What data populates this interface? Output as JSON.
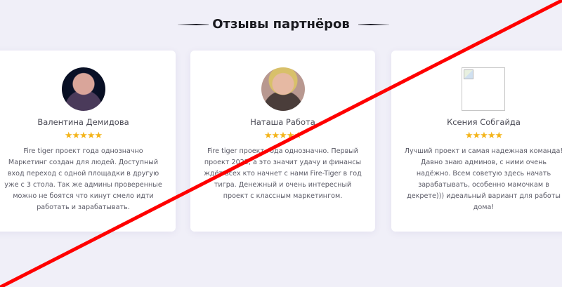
{
  "section": {
    "title": "Отзывы партнёров"
  },
  "reviews": [
    {
      "name": "Валентина Демидова",
      "rating": 5,
      "stars": "★★★★★",
      "text": "Fire tiger проект года однозначно Маркетинг создан для людей. Доступный вход переход с одной площадки в другую уже с 3 стола. Так же админы проверенные можно не боятся что кинут смело идти работать и зарабатывать.",
      "avatar": "photo"
    },
    {
      "name": "Наташа Работа",
      "rating": 5,
      "stars": "★★★★★",
      "text": "Fire tiger проект года однозначно. Первый проект 2022, а это значит удачу и финансы ждёт всех кто начнет с нами Fire-Tiger в год тигра. Денежный и очень интересный проект с классным маркетингом.",
      "avatar": "photo"
    },
    {
      "name": "Ксения Собгайда",
      "rating": 5,
      "stars": "★★★★★",
      "text": "Лучший проект и самая надежная команда! Давно знаю админов, с ними очень надёжно. Всем советую здесь начать зарабатывать, особенно мамочкам в декрете))) идеальный вариант для работы дома!",
      "avatar": "broken-image-icon"
    }
  ],
  "colors": {
    "background": "#f0eff8",
    "card": "#ffffff",
    "star": "#f4b41a",
    "overlay_line": "#ff0000"
  }
}
